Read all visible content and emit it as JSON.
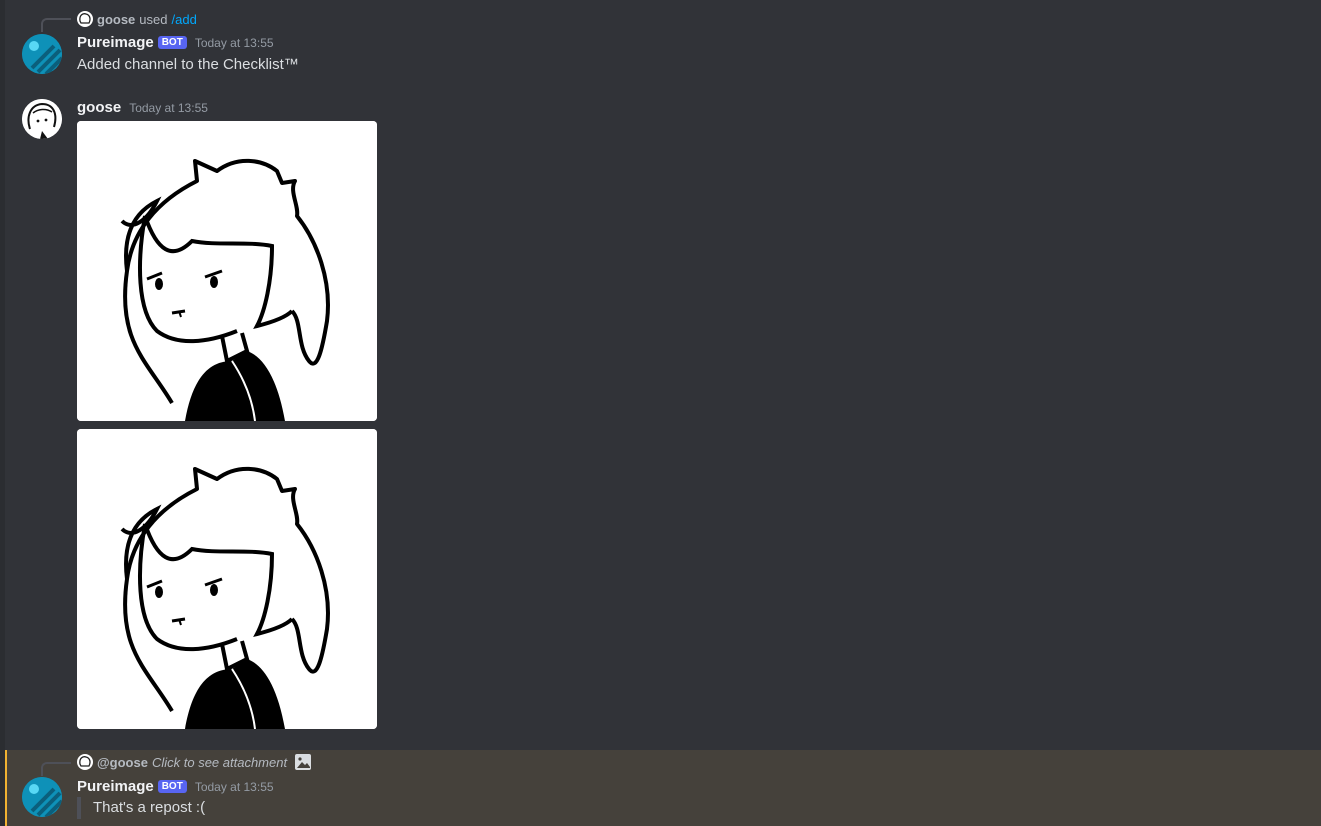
{
  "messages": {
    "first": {
      "reply": {
        "name": "goose",
        "used_text": "used",
        "command": "/add"
      },
      "author": "Pureimage",
      "bot_tag": "BOT",
      "timestamp": "Today at 13:55",
      "content": "Added channel to the Checklist™"
    },
    "second": {
      "author": "goose",
      "timestamp": "Today at 13:55",
      "attachments": [
        "cartoon-girl-drawing",
        "cartoon-girl-drawing"
      ]
    },
    "third": {
      "reply": {
        "mention": "@goose",
        "attachment_text": "Click to see attachment"
      },
      "author": "Pureimage",
      "bot_tag": "BOT",
      "timestamp": "Today at 13:55",
      "content": "That's a repost :("
    }
  },
  "colors": {
    "background": "#313338",
    "highlight": "#45413b",
    "highlight_border": "#f0b232",
    "bot_tag": "#5865f2",
    "link": "#00a8fc"
  }
}
